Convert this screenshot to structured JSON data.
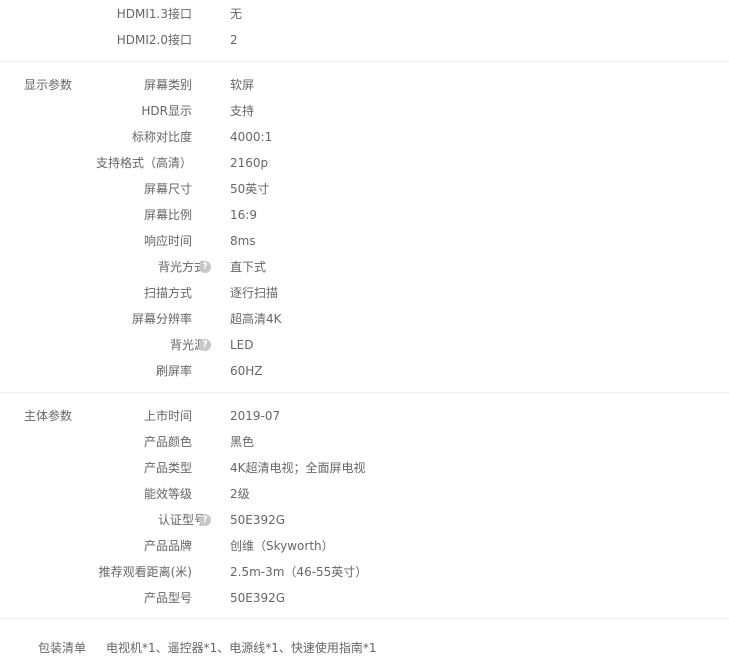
{
  "interface_top": [
    {
      "label": "HDMI1.3接口",
      "value": "无"
    },
    {
      "label": "HDMI2.0接口",
      "value": "2"
    }
  ],
  "display": {
    "title": "显示参数",
    "rows": [
      {
        "label": "屏幕类别",
        "value": "软屏",
        "help": false
      },
      {
        "label": "HDR显示",
        "value": "支持",
        "help": false
      },
      {
        "label": "标称对比度",
        "value": "4000:1",
        "help": false
      },
      {
        "label": "支持格式（高清）",
        "value": "2160p",
        "help": false
      },
      {
        "label": "屏幕尺寸",
        "value": "50英寸",
        "help": false
      },
      {
        "label": "屏幕比例",
        "value": "16:9",
        "help": false
      },
      {
        "label": "响应时间",
        "value": "8ms",
        "help": false
      },
      {
        "label": "背光方式",
        "value": "直下式",
        "help": true
      },
      {
        "label": "扫描方式",
        "value": "逐行扫描",
        "help": false
      },
      {
        "label": "屏幕分辨率",
        "value": "超高清4K",
        "help": false
      },
      {
        "label": "背光源",
        "value": "LED",
        "help": true
      },
      {
        "label": "刷屏率",
        "value": "60HZ",
        "help": false
      }
    ]
  },
  "main": {
    "title": "主体参数",
    "rows": [
      {
        "label": "上市时间",
        "value": "2019-07",
        "help": false
      },
      {
        "label": "产品颜色",
        "value": "黑色",
        "help": false
      },
      {
        "label": "产品类型",
        "value": "4K超清电视；全面屏电视",
        "help": false
      },
      {
        "label": "能效等级",
        "value": "2级",
        "help": false
      },
      {
        "label": "认证型号",
        "value": "50E392G",
        "help": true
      },
      {
        "label": "产品品牌",
        "value": "创维（Skyworth）",
        "help": false
      },
      {
        "label": "推荐观看距离(米)",
        "value": "2.5m-3m（46-55英寸）",
        "help": false
      },
      {
        "label": "产品型号",
        "value": "50E392G",
        "help": false
      }
    ]
  },
  "package": {
    "label": "包装清单",
    "value": "电视机*1、遥控器*1、电源线*1、快速使用指南*1"
  },
  "help_glyph": "?"
}
